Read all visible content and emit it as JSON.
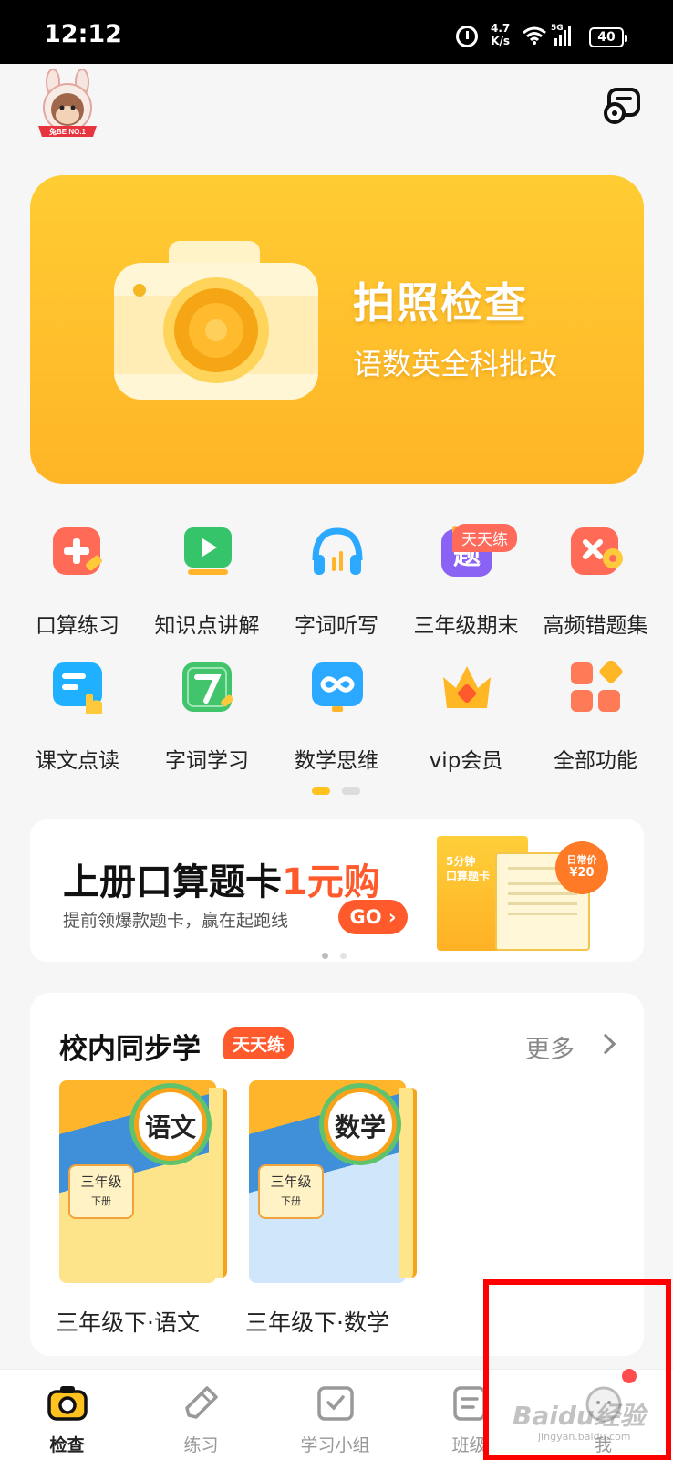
{
  "status_bar": {
    "time": "12:12",
    "net_speed": "4.7\nK/s",
    "network": "5G",
    "battery": "40"
  },
  "header": {
    "logo_text": "兔BE NO.1"
  },
  "hero": {
    "title": "拍照检查",
    "subtitle": "语数英全科批改"
  },
  "features": [
    {
      "label": "口算练习",
      "icon": "calc-practice-icon",
      "color": "#ff6b57"
    },
    {
      "label": "知识点讲解",
      "icon": "video-lesson-icon",
      "color": "#36c46b"
    },
    {
      "label": "字词听写",
      "icon": "headphones-icon",
      "color": "#2ba8ff"
    },
    {
      "label": "三年级期末",
      "icon": "ti-question-icon",
      "color": "#8a63f5"
    },
    {
      "label": "高频错题集",
      "icon": "wrong-questions-icon",
      "color": "#ff6b57"
    },
    {
      "label": "课文点读",
      "icon": "text-reading-icon",
      "color": "#1fb1ff"
    },
    {
      "label": "字词学习",
      "icon": "word-learning-icon",
      "color": "#42c46c"
    },
    {
      "label": "数学思维",
      "icon": "math-thinking-icon",
      "color": "#2ba8ff"
    },
    {
      "label": "vip会员",
      "icon": "vip-crown-icon",
      "color": "#ffb726"
    },
    {
      "label": "全部功能",
      "icon": "all-functions-icon",
      "color": "#ff7a57"
    }
  ],
  "feature_tag": "天天练",
  "promo": {
    "headline": "上册口算题卡",
    "headline_highlight": "1元购",
    "sub": "提前领爆款题卡，赢在起跑线",
    "button": "GO",
    "book_text": "5分钟\n口算题卡",
    "price_label": "日常价",
    "price": "¥20"
  },
  "sync": {
    "title": "校内同步学",
    "tag": "天天练",
    "more": "更多",
    "books": [
      {
        "subject": "语文",
        "grade": "三年级",
        "volume": "下册",
        "name": "三年级下·语文",
        "bottom_color": "#fde38a"
      },
      {
        "subject": "数学",
        "grade": "三年级",
        "volume": "下册",
        "name": "三年级下·数学",
        "bottom_color": "#cfe6fb"
      }
    ]
  },
  "nav": [
    {
      "label": "检查",
      "icon": "camera-icon",
      "active": true
    },
    {
      "label": "练习",
      "icon": "pencil-icon",
      "active": false
    },
    {
      "label": "学习小组",
      "icon": "group-check-icon",
      "active": false
    },
    {
      "label": "班级",
      "icon": "class-icon",
      "active": false
    },
    {
      "label": "我",
      "icon": "profile-icon",
      "active": false
    }
  ],
  "watermark": {
    "text": "Baidu经验",
    "sub": "jingyan.baidu.com"
  }
}
